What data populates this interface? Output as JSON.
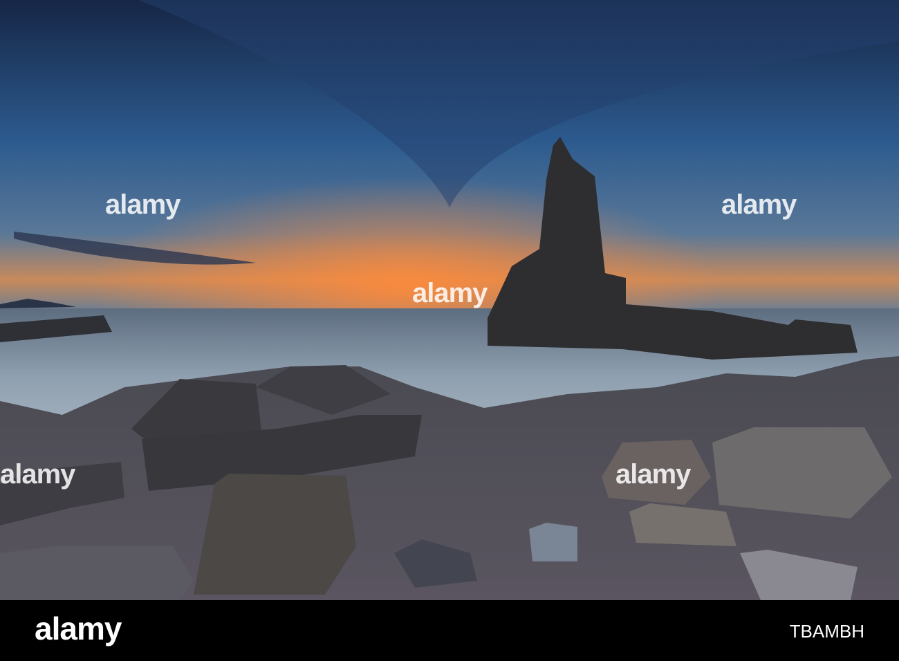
{
  "watermark_text": "alamy",
  "footer": {
    "logo": "alamy",
    "image_code": "TBAMBH"
  },
  "colors": {
    "sky_top": "#1c2e52",
    "sky_mid": "#2f5a8c",
    "horizon_glow": "#f08a3c",
    "sea": "#7d8fa0",
    "rocks": "#3a3b40",
    "bar": "#000000"
  }
}
